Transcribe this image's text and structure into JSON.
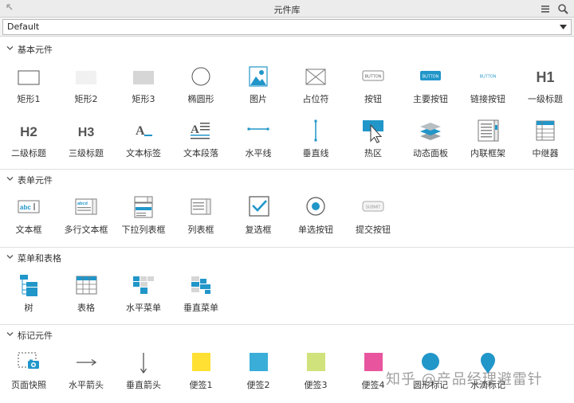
{
  "window": {
    "title": "元件库"
  },
  "library_select": {
    "value": "Default"
  },
  "sections": [
    {
      "title": "基本元件",
      "items": [
        "矩形1",
        "矩形2",
        "矩形3",
        "椭圆形",
        "图片",
        "占位符",
        "按钮",
        "主要按钮",
        "链接按钮",
        "一级标题",
        "二级标题",
        "三级标题",
        "文本标签",
        "文本段落",
        "水平线",
        "垂直线",
        "热区",
        "动态面板",
        "内联框架",
        "中继器"
      ]
    },
    {
      "title": "表单元件",
      "items": [
        "文本框",
        "多行文本框",
        "下拉列表框",
        "列表框",
        "复选框",
        "单选按钮",
        "提交按钮"
      ]
    },
    {
      "title": "菜单和表格",
      "items": [
        "树",
        "表格",
        "水平菜单",
        "垂直菜单"
      ]
    },
    {
      "title": "标记元件",
      "items": [
        "页面快照",
        "水平箭头",
        "垂直箭头",
        "便签1",
        "便签2",
        "便签3",
        "便签4",
        "圆形标记",
        "水滴标记"
      ]
    }
  ],
  "icon_text": {
    "button": "BUTTON",
    "h1": "H1",
    "h2": "H2",
    "h3": "H3",
    "a": "A",
    "abc": "abc",
    "submit": "SUBMIT"
  },
  "watermark": "知乎 @产品经理避雷针",
  "colors": {
    "accent": "#2196c9",
    "sticky_yellow": "#ffe033",
    "sticky_blue": "#3aaed8",
    "sticky_green": "#cfe27b",
    "sticky_pink": "#e8559e"
  }
}
